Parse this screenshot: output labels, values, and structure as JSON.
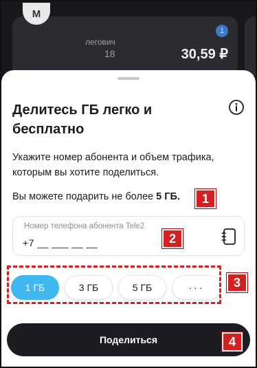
{
  "background": {
    "avatar_letter": "M",
    "card": {
      "badge": "1",
      "name": "легович",
      "number": "18",
      "balance": "30,59 ₽"
    }
  },
  "sheet": {
    "title": "Делитесь ГБ легко и бесплатно",
    "description": "Укажите номер абонента и объем трафика, которым вы хотите поделиться.",
    "limit_prefix": "Вы можете подарить не более ",
    "limit_value": "5 ГБ.",
    "phone_field": {
      "label": "Номер телефона абонента Tele2",
      "value": "+7 __ ___ __ __"
    },
    "chips": [
      {
        "label": "1 ГБ",
        "selected": true
      },
      {
        "label": "3 ГБ",
        "selected": false
      },
      {
        "label": "5 ГБ",
        "selected": false
      },
      {
        "label": "···",
        "selected": false
      }
    ],
    "share_button": "Поделиться"
  },
  "annotations": [
    "1",
    "2",
    "3",
    "4"
  ],
  "colors": {
    "accent": "#3fb8f0",
    "button_dark": "#1c1d22",
    "annotation_red": "#d42020"
  }
}
